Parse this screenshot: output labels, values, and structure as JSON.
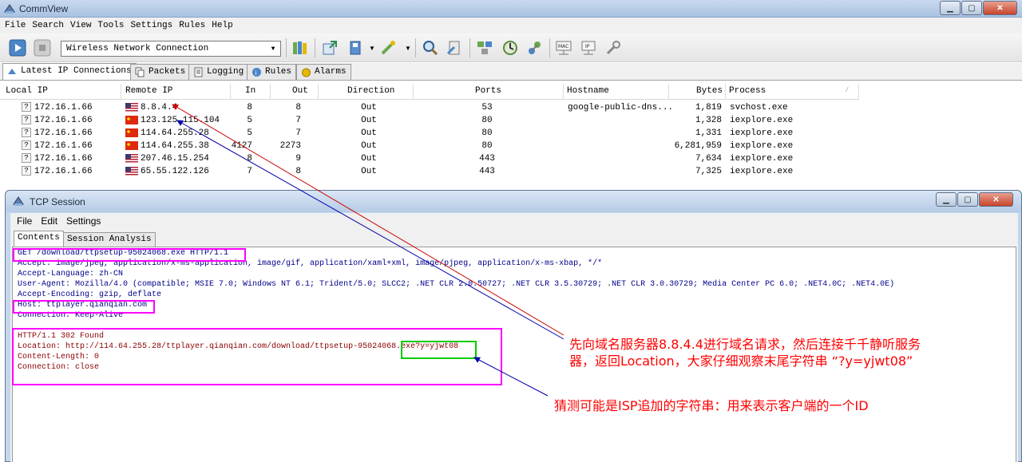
{
  "window": {
    "title": "CommView"
  },
  "menubar": [
    "File",
    "Search",
    "View",
    "Tools",
    "Settings",
    "Rules",
    "Help"
  ],
  "toolbar": {
    "adapter": "Wireless Network Connection",
    "buttons": [
      "start-capture",
      "stop-capture",
      "open-log",
      "new-window",
      "save",
      "rules",
      "search",
      "reconstruct-session",
      "nodes",
      "statistics",
      "alarms",
      "mac-aliases",
      "ip-aliases",
      "settings"
    ]
  },
  "tabs": [
    "Latest IP Connections",
    "Packets",
    "Logging",
    "Rules",
    "Alarms"
  ],
  "connections": {
    "headers": [
      "Local IP",
      "Remote IP",
      "In",
      "Out",
      "Direction",
      "Ports",
      "Hostname",
      "Bytes",
      "Process"
    ],
    "rows": [
      {
        "local": "172.16.1.66",
        "flag": "us",
        "remote": "8.8.4.4",
        "in": "8",
        "out": "8",
        "direction": "Out",
        "ports": "53",
        "hostname": "google-public-dns...",
        "bytes": "1,819",
        "process": "svchost.exe"
      },
      {
        "local": "172.16.1.66",
        "flag": "cn",
        "remote": "123.125.115.104",
        "in": "5",
        "out": "7",
        "direction": "Out",
        "ports": "80",
        "hostname": "",
        "bytes": "1,328",
        "process": "iexplore.exe"
      },
      {
        "local": "172.16.1.66",
        "flag": "cn",
        "remote": "114.64.255.28",
        "in": "5",
        "out": "7",
        "direction": "Out",
        "ports": "80",
        "hostname": "",
        "bytes": "1,331",
        "process": "iexplore.exe"
      },
      {
        "local": "172.16.1.66",
        "flag": "cn",
        "remote": "114.64.255.38",
        "in": "4127",
        "out": "2273",
        "direction": "Out",
        "ports": "80",
        "hostname": "",
        "bytes": "6,281,959",
        "process": "iexplore.exe"
      },
      {
        "local": "172.16.1.66",
        "flag": "us",
        "remote": "207.46.15.254",
        "in": "8",
        "out": "9",
        "direction": "Out",
        "ports": "443",
        "hostname": "",
        "bytes": "7,634",
        "process": "iexplore.exe"
      },
      {
        "local": "172.16.1.66",
        "flag": "us",
        "remote": "65.55.122.126",
        "in": "7",
        "out": "8",
        "direction": "Out",
        "ports": "443",
        "hostname": "",
        "bytes": "7,325",
        "process": "iexplore.exe"
      }
    ]
  },
  "tcp_session": {
    "title": "TCP Session",
    "menu": [
      "File",
      "Edit",
      "Settings"
    ],
    "tabs": [
      "Contents",
      "Session Analysis"
    ],
    "request_lines": [
      "GET /download/ttpsetup-95024068.exe HTTP/1.1",
      "Accept: image/jpeg, application/x-ms-application, image/gif, application/xaml+xml, image/pjpeg, application/x-ms-xbap, */*",
      "Accept-Language: zh-CN",
      "User-Agent: Mozilla/4.0 (compatible; MSIE 7.0; Windows NT 6.1; Trident/5.0; SLCC2; .NET CLR 2.0.50727; .NET CLR 3.5.30729; .NET CLR 3.0.30729; Media Center PC 6.0; .NET4.0C; .NET4.0E)",
      "Accept-Encoding: gzip, deflate",
      "Host: ttplayer.qianqian.com",
      "Connection: Keep-Alive"
    ],
    "response_lines": [
      "HTTP/1.1 302 Found",
      "Location: http://114.64.255.28/ttplayer.qianqian.com/download/ttpsetup-95024068.exe?y=yjwt08",
      "Content-Length: 0",
      "Connection: close"
    ]
  },
  "annotations": {
    "note1_line1": "先向域名服务器8.8.4.4进行域名请求，然后连接千千静听服务",
    "note1_line2": "器，返回Location，大家仔细观察末尾字符串 “?y=yjwt08”",
    "note2": "猜测可能是ISP追加的字符串：用来表示客户端的一个ID"
  },
  "colors": {
    "annotation_text": "#ff0000",
    "highlight_box": "#ff00ff",
    "highlight_box_green": "#00cc00",
    "arrow_red": "#cc0000",
    "arrow_blue": "#0000aa",
    "request_text": "#00008b",
    "response_text": "#8b0000"
  }
}
